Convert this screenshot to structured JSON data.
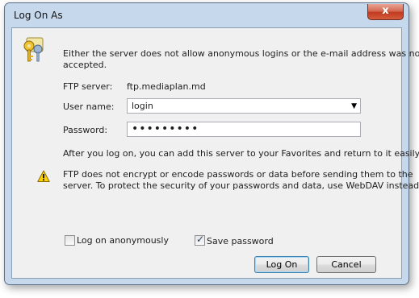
{
  "window": {
    "title": "Log On As",
    "close_symbol": "x"
  },
  "message": {
    "line1": "Either the server does not allow anonymous logins or the e-mail address was not",
    "line2": "accepted."
  },
  "ftp_server": {
    "label": "FTP server:",
    "value": "ftp.mediaplan.md"
  },
  "user_name": {
    "label": "User name:",
    "value": "login"
  },
  "password": {
    "label": "Password:",
    "masked_value": "•••••••••"
  },
  "favorites_note": "After you log on, you can add this server to your Favorites and return to it easily.",
  "warning": {
    "line1": "FTP does not encrypt or encode passwords or data before sending them to the",
    "line2": "server.  To protect the security of your passwords and data, use WebDAV instead."
  },
  "options": {
    "anonymous": {
      "label": "Log on anonymously",
      "checked": false
    },
    "save_password": {
      "label": "Save password",
      "checked": true
    }
  },
  "buttons": {
    "logon": "Log On",
    "cancel": "Cancel"
  },
  "icons": {
    "keys": "keys-icon",
    "warning": "warning-icon",
    "close": "close-icon"
  },
  "colors": {
    "frame": "#c6d9ec",
    "close_button": "#c13b20",
    "warning_yellow": "#ffd200"
  }
}
